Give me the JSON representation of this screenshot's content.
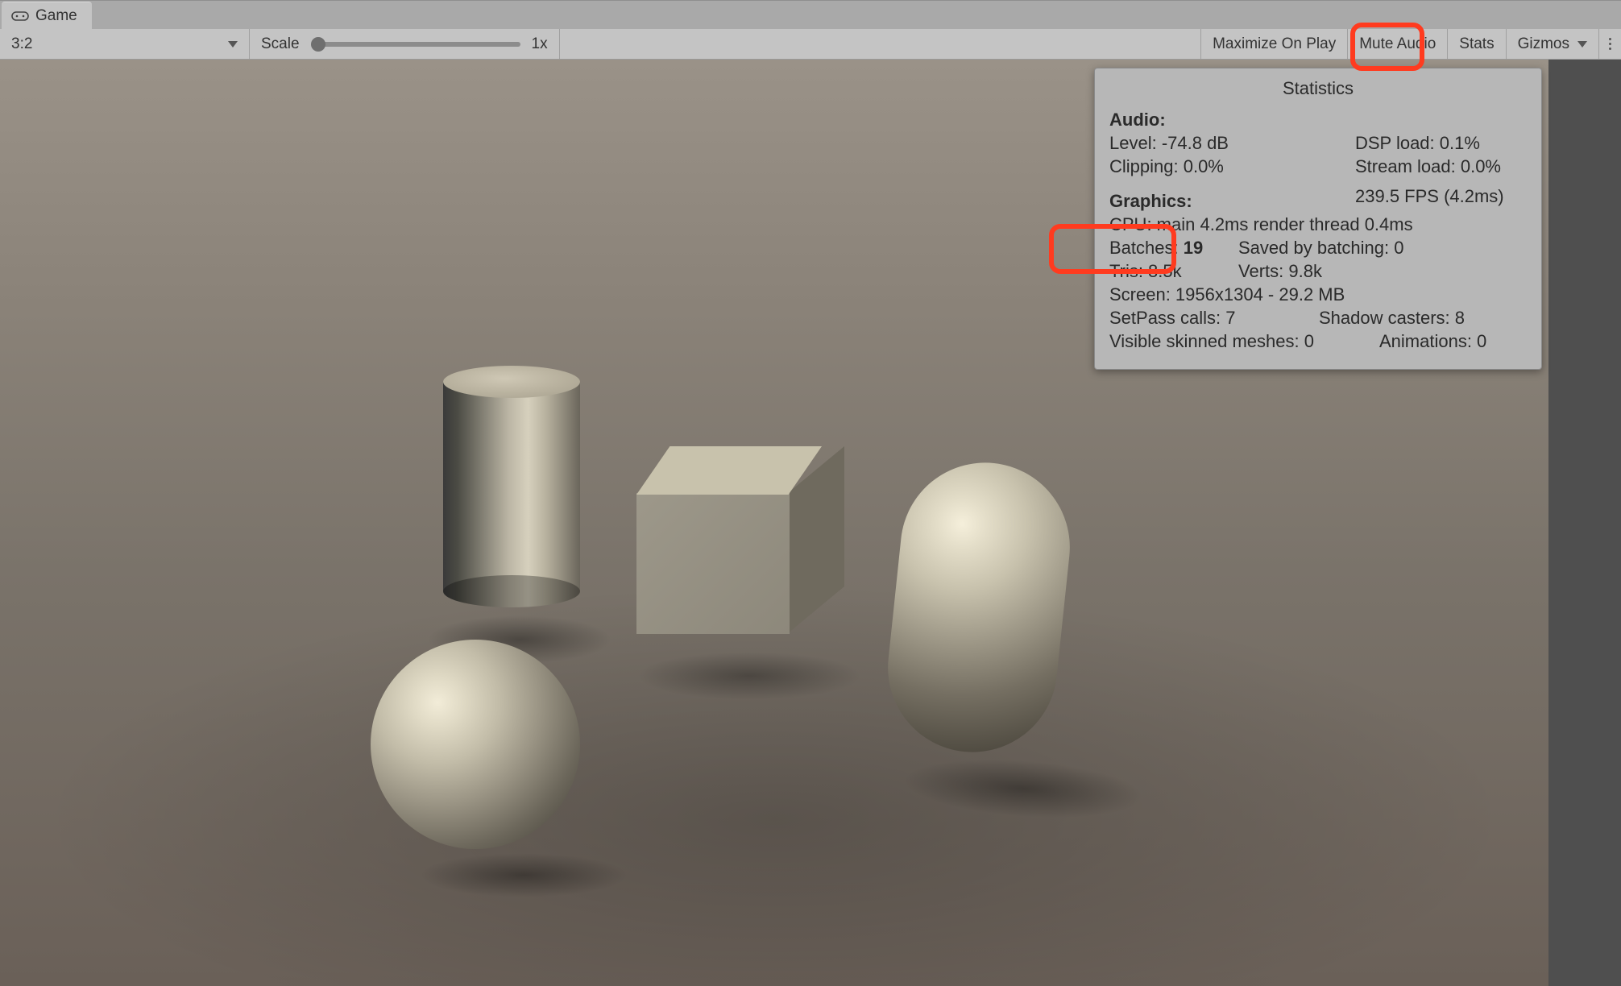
{
  "tab": {
    "label": "Game"
  },
  "toolbar": {
    "aspect": "3:2",
    "scale_label": "Scale",
    "scale_value": "1x",
    "maximize": "Maximize On Play",
    "mute": "Mute Audio",
    "stats": "Stats",
    "gizmos": "Gizmos"
  },
  "stats": {
    "title": "Statistics",
    "audio_header": "Audio:",
    "level": "Level: -74.8 dB",
    "dsp": "DSP load: 0.1%",
    "clipping": "Clipping: 0.0%",
    "stream": "Stream load: 0.0%",
    "graphics_header": "Graphics:",
    "fps": "239.5 FPS (4.2ms)",
    "cpu": "CPU: main 4.2ms  render thread 0.4ms",
    "batches_label": "Batches: ",
    "batches_value": "19",
    "saved": "Saved by batching: 0",
    "tris": "Tris: 8.5k",
    "verts": "Verts: 9.8k",
    "screen": "Screen: 1956x1304 - 29.2 MB",
    "setpass": "SetPass calls: 7",
    "shadow": "Shadow casters: 8",
    "skinned": "Visible skinned meshes: 0",
    "anim": "Animations: 0"
  }
}
